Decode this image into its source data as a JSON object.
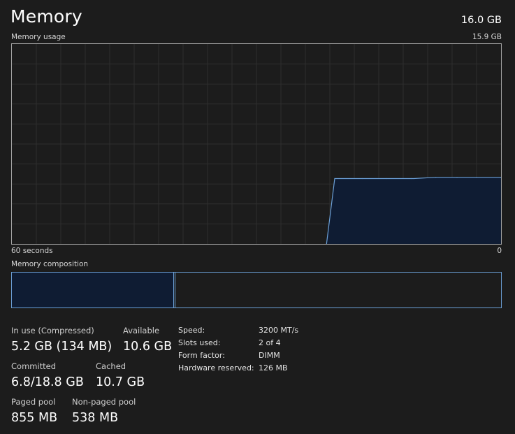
{
  "header": {
    "title": "Memory",
    "total_capacity": "16.0 GB"
  },
  "usage_chart": {
    "label": "Memory usage",
    "max_label": "15.9 GB",
    "x_start_label": "60 seconds",
    "x_end_label": "0"
  },
  "composition": {
    "label": "Memory composition",
    "in_use_fraction": 0.33,
    "modified_fraction": 0.003
  },
  "stats": {
    "in_use": {
      "label": "In use (Compressed)",
      "value": "5.2 GB (134 MB)"
    },
    "available": {
      "label": "Available",
      "value": "10.6 GB"
    },
    "committed": {
      "label": "Committed",
      "value": "6.8/18.8 GB"
    },
    "cached": {
      "label": "Cached",
      "value": "10.7 GB"
    },
    "paged_pool": {
      "label": "Paged pool",
      "value": "855 MB"
    },
    "non_paged_pool": {
      "label": "Non-paged pool",
      "value": "538 MB"
    }
  },
  "specs": {
    "speed": {
      "label": "Speed:",
      "value": "3200 MT/s"
    },
    "slots_used": {
      "label": "Slots used:",
      "value": "2 of 4"
    },
    "form_factor": {
      "label": "Form factor:",
      "value": "DIMM"
    },
    "hardware_reserved": {
      "label": "Hardware reserved:",
      "value": "126 MB"
    }
  },
  "colors": {
    "background": "#1c1c1c",
    "grid": "#2e2e2e",
    "chart_border": "#a6a6a6",
    "accent_line": "#6b9fd6",
    "accent_fill": "#0f1c33"
  },
  "chart_data": {
    "type": "area",
    "title": "Memory usage",
    "xlabel": "",
    "ylabel": "",
    "x_unit": "seconds ago",
    "xlim": [
      60,
      0
    ],
    "ylim": [
      0,
      15.9
    ],
    "grid": true,
    "series": [
      {
        "values": [
          {
            "x": 21.4,
            "y": 0.0
          },
          {
            "x": 20.4,
            "y": 5.2
          },
          {
            "x": 17.0,
            "y": 5.2
          },
          {
            "x": 14.0,
            "y": 5.2
          },
          {
            "x": 11.0,
            "y": 5.2
          },
          {
            "x": 10.7,
            "y": 5.2
          },
          {
            "x": 8.0,
            "y": 5.3
          },
          {
            "x": 5.4,
            "y": 5.3
          },
          {
            "x": 3.0,
            "y": 5.3
          },
          {
            "x": 0.0,
            "y": 5.3
          }
        ]
      }
    ]
  }
}
